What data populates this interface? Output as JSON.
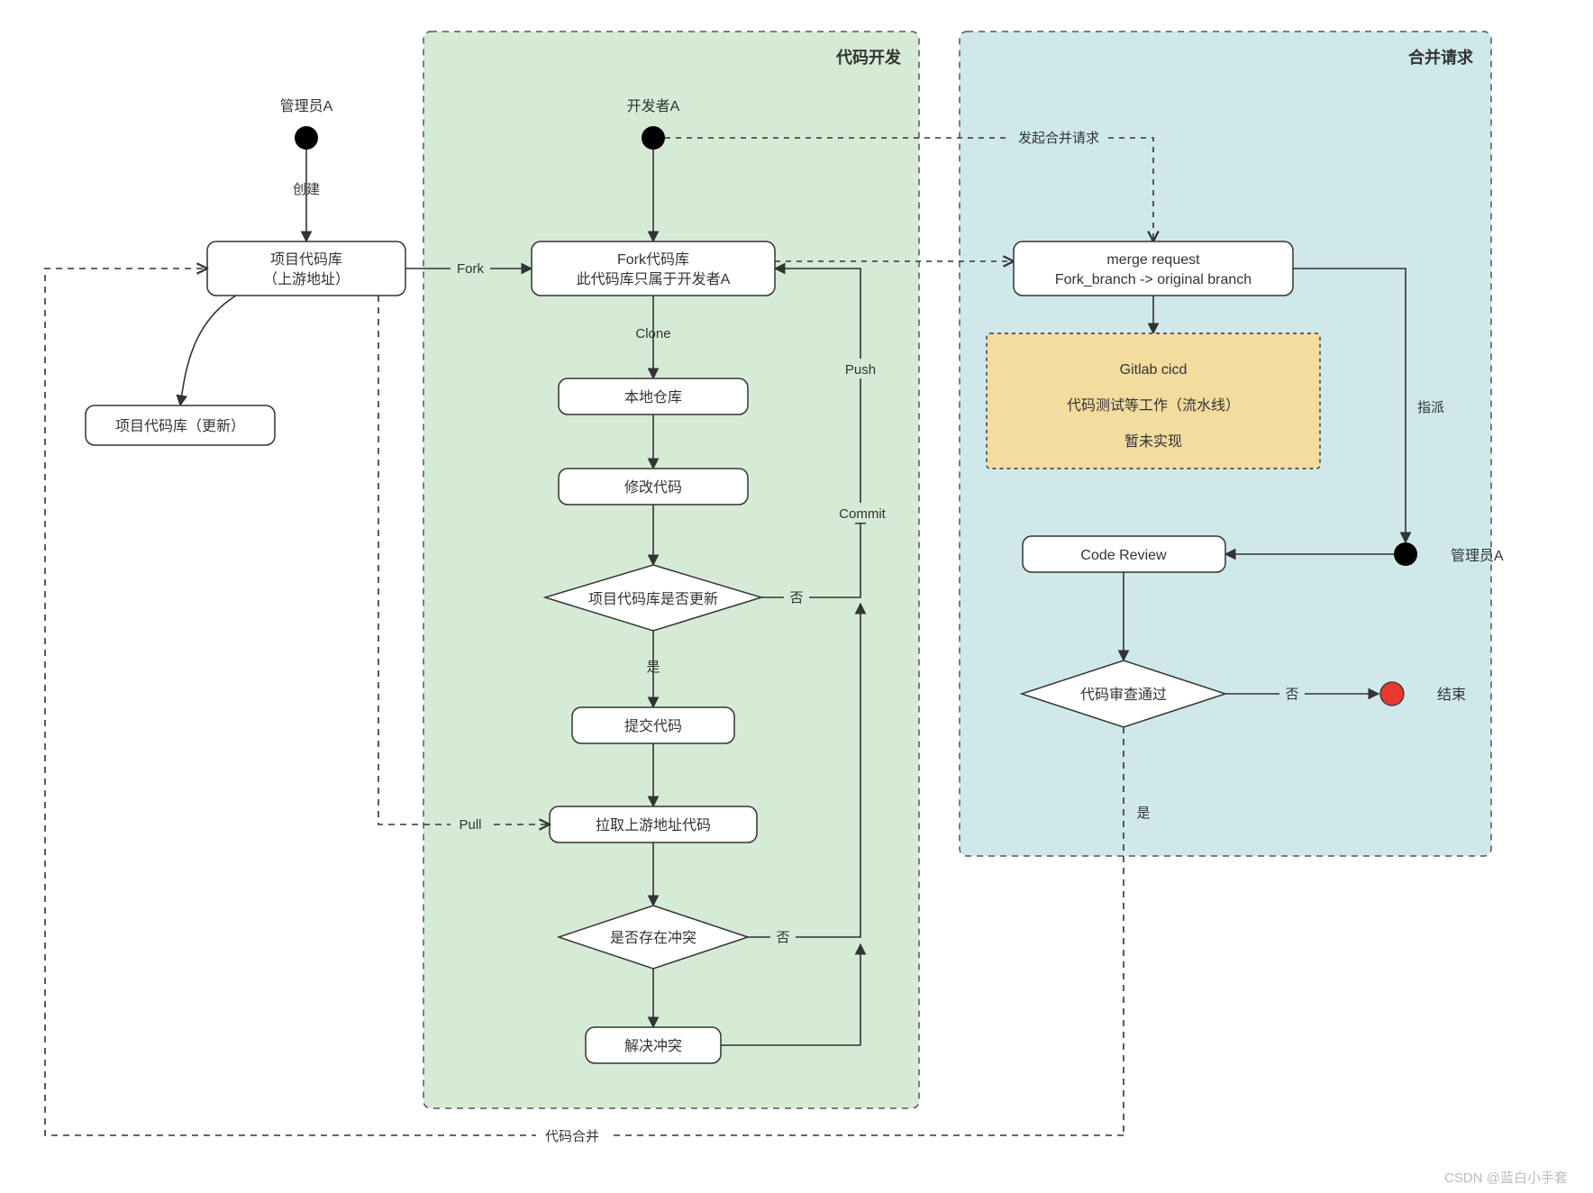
{
  "groups": {
    "dev": {
      "title": "代码开发"
    },
    "merge": {
      "title": "合并请求"
    }
  },
  "actors": {
    "adminA": "管理员A",
    "devA": "开发者A",
    "adminA2": "管理员A"
  },
  "nodes": {
    "repo": {
      "l1": "项目代码库",
      "l2": "（上游地址）"
    },
    "repoUpdated": "项目代码库（更新）",
    "forkRepo": {
      "l1": "Fork代码库",
      "l2": "此代码库只属于开发者A"
    },
    "local": "本地仓库",
    "modify": "修改代码",
    "repoChanged": "项目代码库是否更新",
    "commit": "提交代码",
    "pullUp": "拉取上游地址代码",
    "conflict": "是否存在冲突",
    "resolve": "解决冲突",
    "mergeReq": {
      "l1": "merge request",
      "l2": "Fork_branch -> original branch"
    },
    "cicd": {
      "l1": "Gitlab cicd",
      "l2": "代码测试等工作（流水线）",
      "l3": "暂未实现"
    },
    "codeReview": "Code Review",
    "reviewPass": "代码审查通过",
    "end": "结束"
  },
  "edges": {
    "create": "创建",
    "fork": "Fork",
    "clone": "Clone",
    "push": "Push",
    "commit": "Commit",
    "yes": "是",
    "no": "否",
    "pull": "Pull",
    "mergeReq": "发起合并请求",
    "assign": "指派",
    "codeMerge": "代码合并"
  },
  "watermark": "CSDN @蓝白小手套"
}
